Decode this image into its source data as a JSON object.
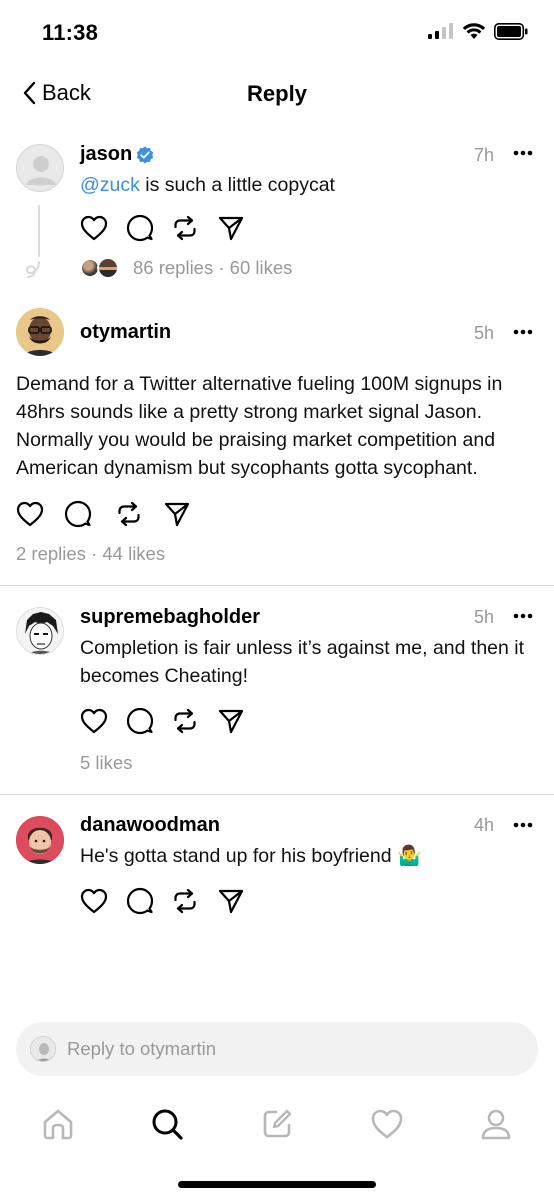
{
  "status_bar": {
    "time": "11:38"
  },
  "nav": {
    "back_label": "Back",
    "title": "Reply"
  },
  "posts": [
    {
      "username": "jason",
      "verified": true,
      "time": "7h",
      "mention": "@zuck",
      "text": " is such a little copycat",
      "stats": "86 replies · 60 likes"
    },
    {
      "username": "otymartin",
      "time": "5h",
      "text": "Demand for a Twitter alternative fueling 100M signups in 48hrs sounds like a pretty strong market signal Jason. Normally you would be praising market competition and American dynamism but sycophants gotta sycophant.",
      "stats": "2 replies · 44 likes"
    },
    {
      "username": "supremebagholder",
      "time": "5h",
      "text": "Completion is fair unless it’s against me, and then it becomes Cheating!",
      "stats": "5 likes"
    },
    {
      "username": "danawoodman",
      "time": "4h",
      "text": "He's gotta stand up for his boyfriend 🤷‍♂️"
    }
  ],
  "reply_input": {
    "placeholder": "Reply to otymartin"
  },
  "tabbar": [
    "home-icon",
    "search-icon",
    "compose-icon",
    "activity-heart-icon",
    "profile-icon"
  ],
  "colors": {
    "accent_link": "#3d8fe0",
    "verified": "#3d8fe0",
    "muted": "#999999"
  }
}
